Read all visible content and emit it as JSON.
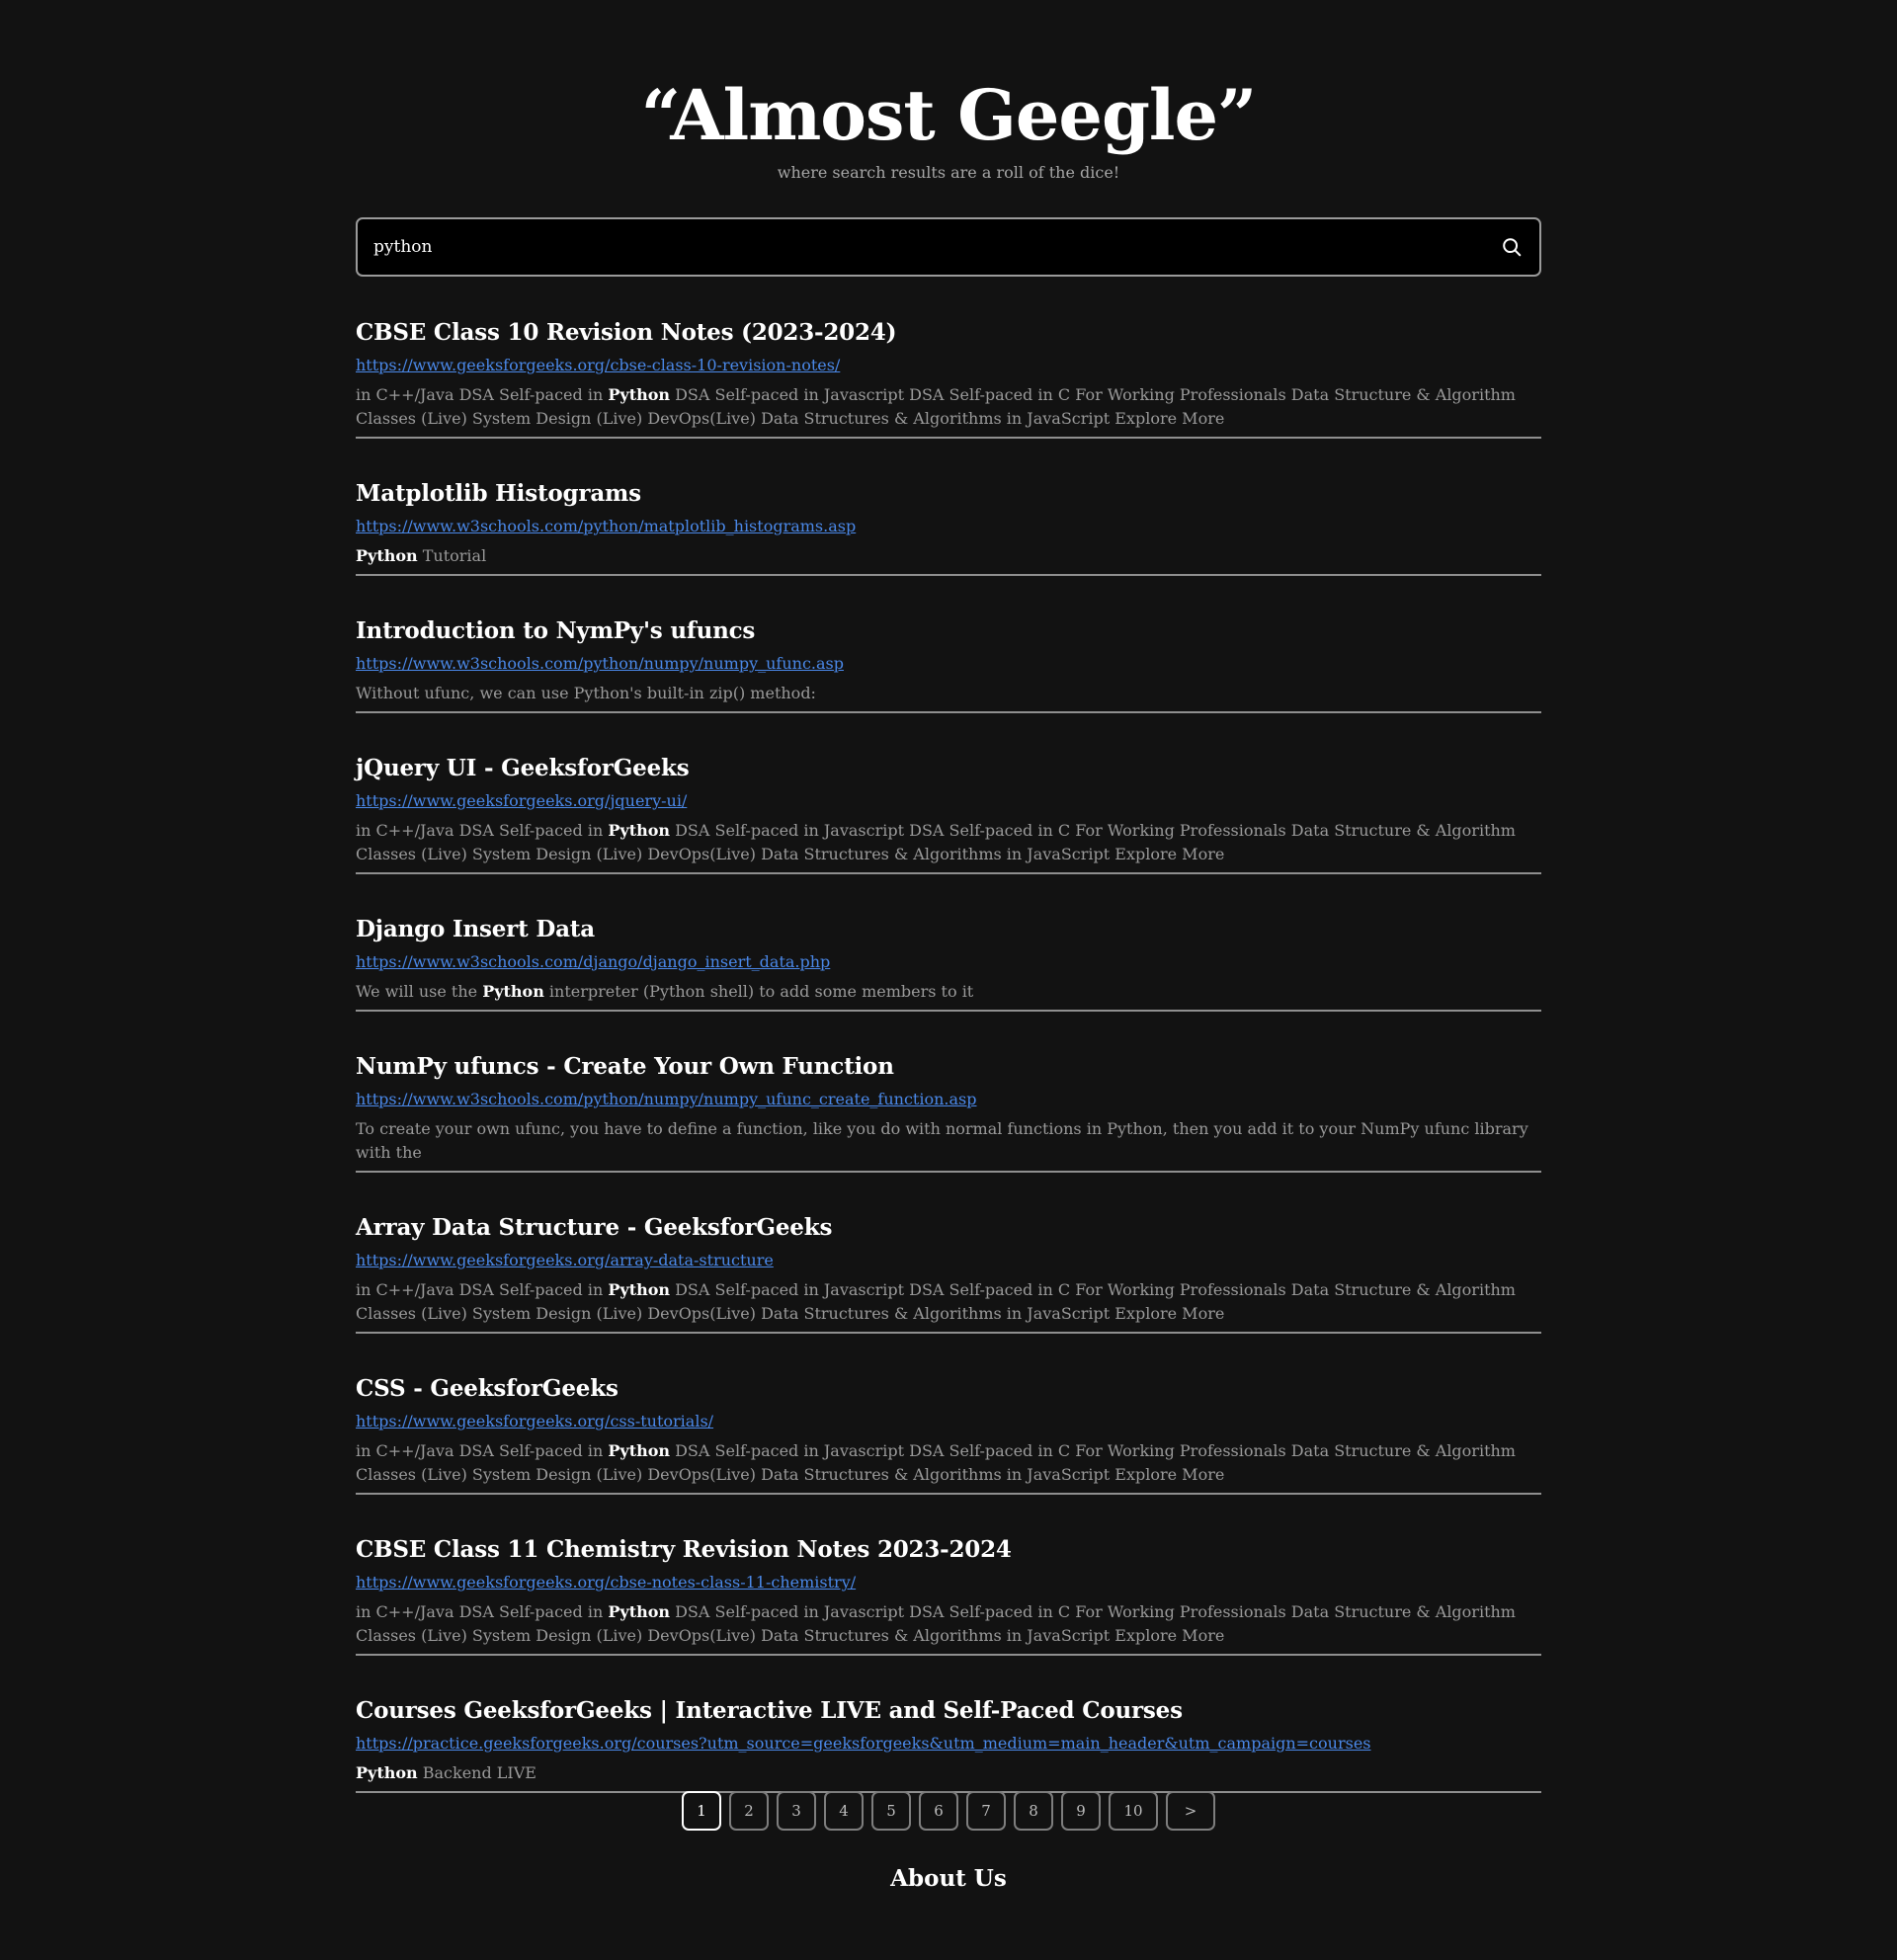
{
  "header": {
    "title": "“Almost Geegle”",
    "tagline": "where search results are a roll of the dice!"
  },
  "search": {
    "value": "python",
    "button_icon": "search-icon"
  },
  "results": [
    {
      "title": "CBSE Class 10 Revision Notes (2023-2024)",
      "url": "https://www.geeksforgeeks.org/cbse-class-10-revision-notes/",
      "snippet_before": "in C++/Java DSA Self-paced in ",
      "snippet_bold": "Python",
      "snippet_after": " DSA Self-paced in Javascript DSA Self-paced in C For Working Professionals Data Structure & Algorithm Classes (Live) System Design (Live) DevOps(Live) Data Structures & Algorithms in JavaScript Explore More"
    },
    {
      "title": "Matplotlib Histograms",
      "url": "https://www.w3schools.com/python/matplotlib_histograms.asp",
      "snippet_before": "",
      "snippet_bold": "Python",
      "snippet_after": " Tutorial"
    },
    {
      "title": "Introduction to NymPy's ufuncs",
      "url": "https://www.w3schools.com/python/numpy/numpy_ufunc.asp",
      "snippet_before": "Without ufunc, we can use Python's built-in zip() method:",
      "snippet_bold": "",
      "snippet_after": ""
    },
    {
      "title": "jQuery UI - GeeksforGeeks",
      "url": "https://www.geeksforgeeks.org/jquery-ui/",
      "snippet_before": "in C++/Java DSA Self-paced in ",
      "snippet_bold": "Python",
      "snippet_after": " DSA Self-paced in Javascript DSA Self-paced in C For Working Professionals Data Structure & Algorithm Classes (Live) System Design (Live) DevOps(Live) Data Structures & Algorithms in JavaScript Explore More"
    },
    {
      "title": "Django Insert Data",
      "url": "https://www.w3schools.com/django/django_insert_data.php",
      "snippet_before": "We will use the ",
      "snippet_bold": "Python",
      "snippet_after": " interpreter (Python shell) to add some members to it"
    },
    {
      "title": "NumPy ufuncs - Create Your Own Function",
      "url": "https://www.w3schools.com/python/numpy/numpy_ufunc_create_function.asp",
      "snippet_before": "To create your own ufunc, you have to define a function, like you do with normal functions in Python, then you add it to your NumPy ufunc library with the",
      "snippet_bold": "",
      "snippet_after": ""
    },
    {
      "title": "Array Data Structure - GeeksforGeeks",
      "url": "https://www.geeksforgeeks.org/array-data-structure",
      "snippet_before": "in C++/Java DSA Self-paced in ",
      "snippet_bold": "Python",
      "snippet_after": " DSA Self-paced in Javascript DSA Self-paced in C For Working Professionals Data Structure & Algorithm Classes (Live) System Design (Live) DevOps(Live) Data Structures & Algorithms in JavaScript Explore More"
    },
    {
      "title": "CSS - GeeksforGeeks",
      "url": "https://www.geeksforgeeks.org/css-tutorials/",
      "snippet_before": "in C++/Java DSA Self-paced in ",
      "snippet_bold": "Python",
      "snippet_after": " DSA Self-paced in Javascript DSA Self-paced in C For Working Professionals Data Structure & Algorithm Classes (Live) System Design (Live) DevOps(Live) Data Structures & Algorithms in JavaScript Explore More"
    },
    {
      "title": "CBSE Class 11 Chemistry Revision Notes 2023-2024",
      "url": "https://www.geeksforgeeks.org/cbse-notes-class-11-chemistry/",
      "snippet_before": "in C++/Java DSA Self-paced in ",
      "snippet_bold": "Python",
      "snippet_after": " DSA Self-paced in Javascript DSA Self-paced in C For Working Professionals Data Structure & Algorithm Classes (Live) System Design (Live) DevOps(Live) Data Structures & Algorithms in JavaScript Explore More"
    },
    {
      "title": "Courses GeeksforGeeks | Interactive LIVE and Self-Paced Courses",
      "url": "https://practice.geeksforgeeks.org/courses?utm_source=geeksforgeeks&utm_medium=main_header&utm_campaign=courses",
      "snippet_before": "",
      "snippet_bold": "Python",
      "snippet_after": " Backend LIVE"
    }
  ],
  "pagination": {
    "pages": [
      "1",
      "2",
      "3",
      "4",
      "5",
      "6",
      "7",
      "8",
      "9",
      "10"
    ],
    "active": "1",
    "next_label": ">"
  },
  "footer": {
    "about_label": "About Us"
  },
  "colors": {
    "background": "#121212",
    "link": "#4a88e8",
    "snippet": "#9a9a9a",
    "divider": "#8f8f8f"
  }
}
